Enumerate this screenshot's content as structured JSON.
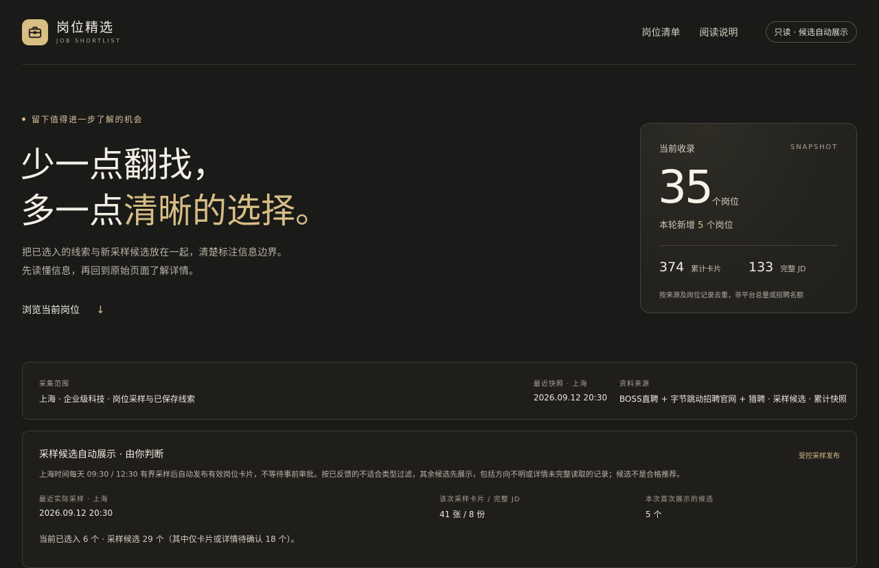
{
  "brand": {
    "title": "岗位精选",
    "subtitle": "JOB SHORTLIST",
    "icon": "briefcase-icon"
  },
  "nav": {
    "links": [
      "岗位清单",
      "阅读说明"
    ],
    "badge": "只读 · 候选自动展示"
  },
  "hero": {
    "eyebrow": "留下值得进一步了解的机会",
    "line1": "少一点翻找，",
    "line2_prefix": "多一点",
    "line2_accent": "清晰的选择。",
    "desc1": "把已选入的线索与新采样候选放在一起，清楚标注信息边界。",
    "desc2": "先读懂信息，再回到原始页面了解详情。",
    "browse_label": "浏览当前岗位",
    "browse_icon": "arrow-down-icon"
  },
  "snapshot": {
    "label": "当前收录",
    "tag": "SNAPSHOT",
    "count": "35",
    "count_unit": "个岗位",
    "new_prefix": "本轮新增",
    "new_count": "5",
    "new_suffix": "个岗位",
    "stats": [
      {
        "value": "374",
        "label": "累计卡片"
      },
      {
        "value": "133",
        "label": "完整 JD"
      }
    ],
    "note": "按来源及岗位记录去重，非平台总量或招聘名额"
  },
  "scope_card": {
    "scope_label": "采集范围",
    "scope_value": "上海 · 企业级科技 · 岗位采样与已保存线索",
    "snapshot_label": "最近快照 · 上海",
    "snapshot_value": "2026.09.12 20:30",
    "source_label": "资料来源",
    "source_value": "BOSS直聘 + 字节跳动招聘官网 + 猎聘 · 采样候选 · 累计快照"
  },
  "candidate_card": {
    "title": "采样候选自动展示 · 由你判断",
    "tag": "受控采样发布",
    "desc": "上海时间每天 09:30 / 12:30 有界采样后自动发布有效岗位卡片，不等待事前审批。按已反馈的不适合类型过滤，其余候选先展示，包括方向不明或详情未完整读取的记录；候选不是合格推荐。",
    "fields": [
      {
        "label": "最近实际采样 · 上海",
        "value": "2026.09.12 20:30"
      },
      {
        "label": "该次采样卡片 / 完整 JD",
        "value": "41 张 / 8 份"
      },
      {
        "label": "本次首次展示的候选",
        "value": "5 个"
      }
    ],
    "summary": "当前已选入 6 个 · 采样候选 29 个（其中仅卡片或详情待确认 18 个）。"
  },
  "colors": {
    "background": "#1a1a18",
    "accent": "#d7bd86",
    "card": "#1f1e1b"
  }
}
